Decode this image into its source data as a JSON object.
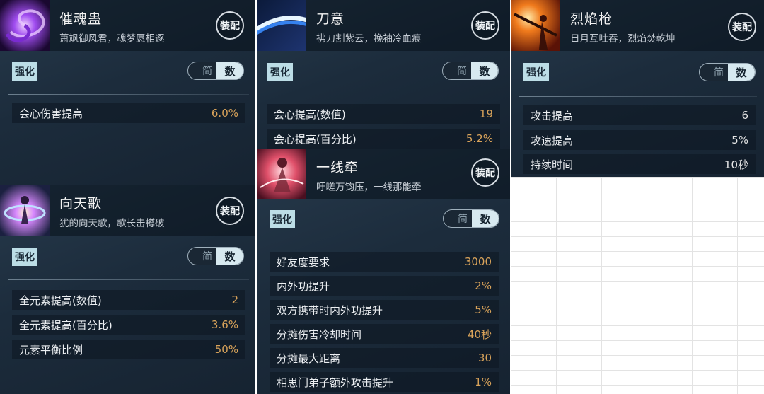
{
  "colors": {
    "value_gold": "#d9a35a",
    "value_white": "#e6e6e6",
    "tag_bg": "#bcdde6"
  },
  "cards": {
    "c0": {
      "name": "催魂蛊",
      "desc": "萧飒御风君，魂梦愿相逐",
      "equip": "装配",
      "tag": "强化",
      "toggle": {
        "simple": "简",
        "number": "数"
      },
      "icon": "purple-vortex-icon",
      "stats": [
        {
          "label": "会心伤害提高",
          "value": "6.0%"
        }
      ]
    },
    "c1": {
      "name": "刀意",
      "desc": "拂刀割紫云，挽袖冷血痕",
      "equip": "装配",
      "tag": "强化",
      "toggle": {
        "simple": "简",
        "number": "数"
      },
      "icon": "blue-slash-icon",
      "stats": [
        {
          "label": "会心提高(数值)",
          "value": "19"
        },
        {
          "label": "会心提高(百分比)",
          "value": "5.2%"
        }
      ]
    },
    "c2": {
      "name": "烈焰枪",
      "desc": "日月互吐吞，烈焰焚乾坤",
      "equip": "装配",
      "tag": "强化",
      "toggle": {
        "simple": "简",
        "number": "数"
      },
      "icon": "flame-spear-icon",
      "stats": [
        {
          "label": "攻击提高",
          "value": "6"
        },
        {
          "label": "攻速提高",
          "value": "5%"
        },
        {
          "label": "持续时间",
          "value": "10秒"
        }
      ]
    },
    "c3": {
      "name": "向天歌",
      "desc": "犹的向天歌，歌长击樽破",
      "equip": "装配",
      "tag": "强化",
      "toggle": {
        "simple": "简",
        "number": "数"
      },
      "icon": "sky-song-icon",
      "stats": [
        {
          "label": "全元素提高(数值)",
          "value": "2"
        },
        {
          "label": "全元素提高(百分比)",
          "value": "3.6%"
        },
        {
          "label": "元素平衡比例",
          "value": "50%"
        }
      ]
    },
    "c4": {
      "name": "一线牵",
      "desc": "吁嗟万钧压，一线那能牵",
      "equip": "装配",
      "tag": "强化",
      "toggle": {
        "simple": "简",
        "number": "数"
      },
      "icon": "red-thread-icon",
      "stats": [
        {
          "label": "好友度要求",
          "value": "3000"
        },
        {
          "label": "内外功提升",
          "value": "2%"
        },
        {
          "label": "双方携带时内外功提升",
          "value": "5%"
        },
        {
          "label": "分摊伤害冷却时间",
          "value": "40秒"
        },
        {
          "label": "分摊最大距离",
          "value": "30"
        },
        {
          "label": "相思门弟子额外攻击提升",
          "value": "1%"
        }
      ]
    }
  }
}
